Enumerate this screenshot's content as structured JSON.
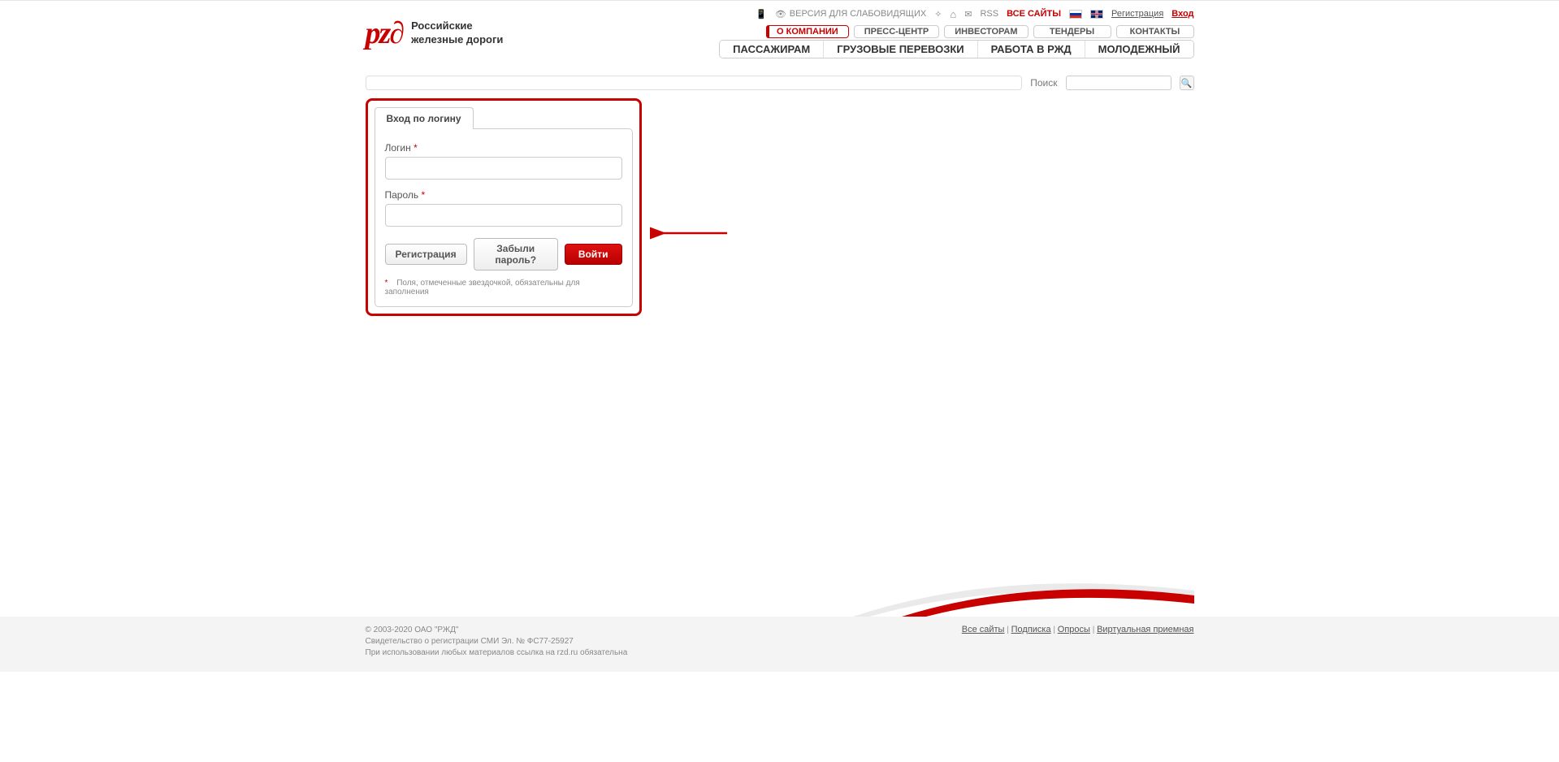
{
  "brand": {
    "logo_text": "pz∂",
    "name_line1": "Российские",
    "name_line2": "железные дороги"
  },
  "topbar": {
    "accessibility": "ВЕРСИЯ ДЛЯ СЛАБОВИДЯЩИХ",
    "rss": "RSS",
    "all_sites": "ВСЕ САЙТЫ",
    "register": "Регистрация",
    "login": "Вход"
  },
  "nav_primary": [
    "О КОМПАНИИ",
    "ПРЕСС-ЦЕНТР",
    "ИНВЕСТОРАМ",
    "ТЕНДЕРЫ",
    "КОНТАКТЫ"
  ],
  "nav_secondary": [
    "ПАССАЖИРАМ",
    "ГРУЗОВЫЕ ПЕРЕВОЗКИ",
    "РАБОТА В РЖД",
    "МОЛОДЕЖНЫЙ"
  ],
  "search": {
    "label": "Поиск",
    "value": ""
  },
  "login_form": {
    "tab": "Вход по логину",
    "login_label": "Логин",
    "password_label": "Пароль",
    "register_btn": "Регистрация",
    "forgot_btn": "Забыли пароль?",
    "submit_btn": "Войти",
    "note": "Поля, отмеченные звездочкой, обязательны для заполнения",
    "required_mark": "*"
  },
  "footer": {
    "copyright": "© 2003-2020 ОАО \"РЖД\"",
    "cert": "Свидетельство о регистрации СМИ Эл. № ФС77-25927",
    "usage": "При использовании любых материалов ссылка на rzd.ru обязательна",
    "links": [
      "Все сайты",
      "Подписка",
      "Опросы",
      "Виртуальная приемная"
    ]
  }
}
